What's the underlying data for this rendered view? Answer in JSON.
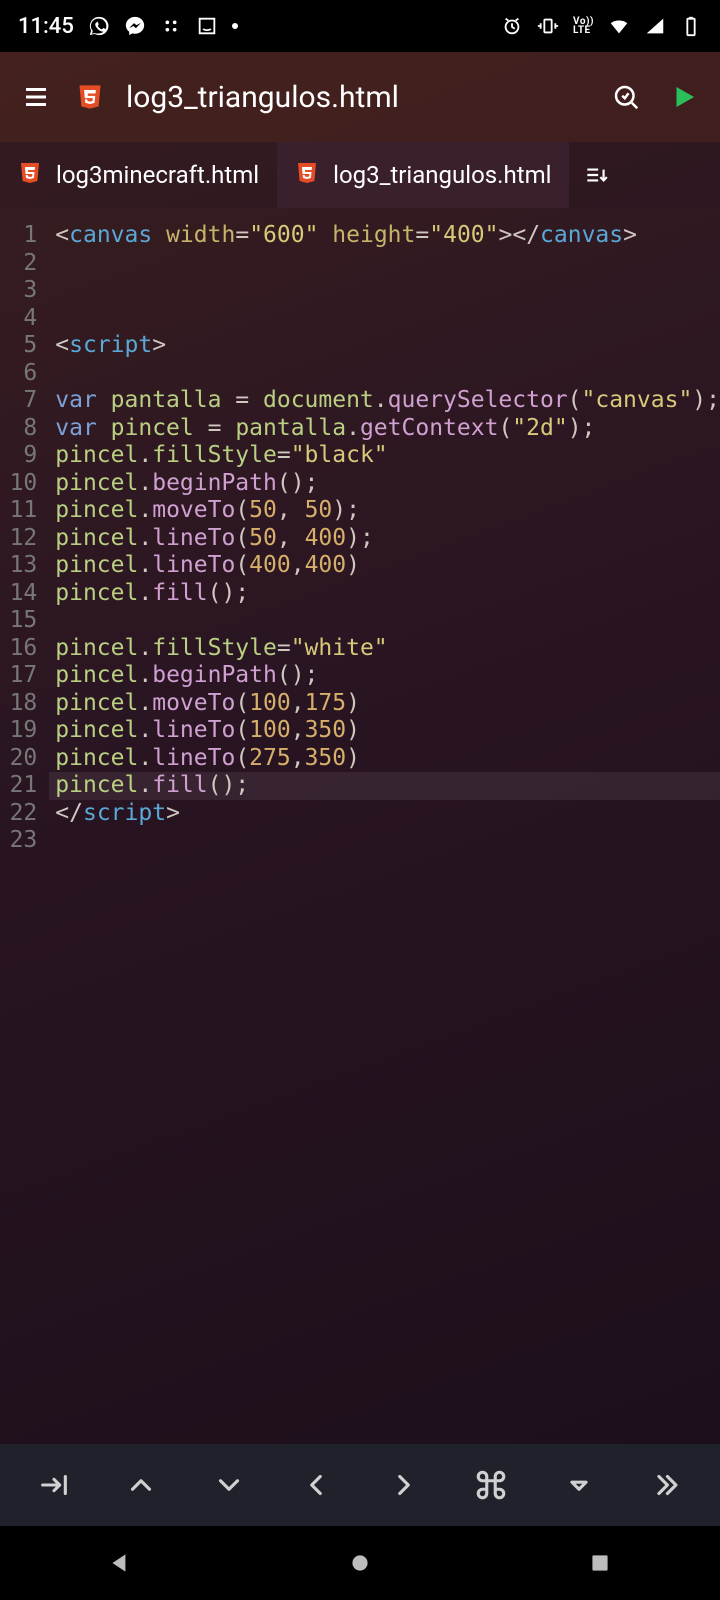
{
  "status": {
    "time": "11:45",
    "volte": "Vo))\nLTE"
  },
  "appbar": {
    "title": "log3_triangulos.html"
  },
  "tabs": [
    {
      "label": "log3minecraft.html",
      "active": false
    },
    {
      "label": "log3_triangulos.html",
      "active": true
    }
  ],
  "editor": {
    "cursor_line": 21,
    "lines": [
      {
        "n": 1,
        "tokens": [
          [
            "t-punc",
            "<"
          ],
          [
            "t-tag",
            "canvas"
          ],
          [
            "t-def",
            " "
          ],
          [
            "t-attr",
            "width"
          ],
          [
            "t-punc",
            "="
          ],
          [
            "t-str",
            "\"600\""
          ],
          [
            "t-def",
            " "
          ],
          [
            "t-attr",
            "height"
          ],
          [
            "t-punc",
            "="
          ],
          [
            "t-str",
            "\"400\""
          ],
          [
            "t-punc",
            "></"
          ],
          [
            "t-tag",
            "canvas"
          ],
          [
            "t-punc",
            ">"
          ]
        ]
      },
      {
        "n": 2,
        "tokens": []
      },
      {
        "n": 3,
        "tokens": []
      },
      {
        "n": 4,
        "tokens": []
      },
      {
        "n": 5,
        "tokens": [
          [
            "t-punc",
            "<"
          ],
          [
            "t-tag",
            "script"
          ],
          [
            "t-punc",
            ">"
          ]
        ]
      },
      {
        "n": 6,
        "tokens": []
      },
      {
        "n": 7,
        "tokens": [
          [
            "t-kw",
            "var"
          ],
          [
            "t-def",
            " "
          ],
          [
            "t-id",
            "pantalla"
          ],
          [
            "t-def",
            " = "
          ],
          [
            "t-id",
            "document"
          ],
          [
            "t-punc",
            "."
          ],
          [
            "t-fn",
            "querySelector"
          ],
          [
            "t-punc",
            "("
          ],
          [
            "t-str",
            "\"canvas\""
          ],
          [
            "t-punc",
            ");"
          ]
        ]
      },
      {
        "n": 8,
        "tokens": [
          [
            "t-kw",
            "var"
          ],
          [
            "t-def",
            " "
          ],
          [
            "t-id",
            "pincel"
          ],
          [
            "t-def",
            " = "
          ],
          [
            "t-id",
            "pantalla"
          ],
          [
            "t-punc",
            "."
          ],
          [
            "t-fn",
            "getContext"
          ],
          [
            "t-punc",
            "("
          ],
          [
            "t-str",
            "\"2d\""
          ],
          [
            "t-punc",
            ");"
          ]
        ]
      },
      {
        "n": 9,
        "tokens": [
          [
            "t-id",
            "pincel"
          ],
          [
            "t-punc",
            "."
          ],
          [
            "t-id",
            "fillStyle"
          ],
          [
            "t-punc",
            "="
          ],
          [
            "t-str",
            "\"black\""
          ]
        ]
      },
      {
        "n": 10,
        "tokens": [
          [
            "t-id",
            "pincel"
          ],
          [
            "t-punc",
            "."
          ],
          [
            "t-fn",
            "beginPath"
          ],
          [
            "t-punc",
            "();"
          ]
        ]
      },
      {
        "n": 11,
        "tokens": [
          [
            "t-id",
            "pincel"
          ],
          [
            "t-punc",
            "."
          ],
          [
            "t-fn",
            "moveTo"
          ],
          [
            "t-punc",
            "("
          ],
          [
            "t-num",
            "50"
          ],
          [
            "t-punc",
            ", "
          ],
          [
            "t-num",
            "50"
          ],
          [
            "t-punc",
            ");"
          ]
        ]
      },
      {
        "n": 12,
        "tokens": [
          [
            "t-id",
            "pincel"
          ],
          [
            "t-punc",
            "."
          ],
          [
            "t-fn",
            "lineTo"
          ],
          [
            "t-punc",
            "("
          ],
          [
            "t-num",
            "50"
          ],
          [
            "t-punc",
            ", "
          ],
          [
            "t-num",
            "400"
          ],
          [
            "t-punc",
            ");"
          ]
        ]
      },
      {
        "n": 13,
        "tokens": [
          [
            "t-id",
            "pincel"
          ],
          [
            "t-punc",
            "."
          ],
          [
            "t-fn",
            "lineTo"
          ],
          [
            "t-punc",
            "("
          ],
          [
            "t-num",
            "400"
          ],
          [
            "t-punc",
            ","
          ],
          [
            "t-num",
            "400"
          ],
          [
            "t-punc",
            ")"
          ]
        ]
      },
      {
        "n": 14,
        "tokens": [
          [
            "t-id",
            "pincel"
          ],
          [
            "t-punc",
            "."
          ],
          [
            "t-fn",
            "fill"
          ],
          [
            "t-punc",
            "();"
          ]
        ]
      },
      {
        "n": 15,
        "tokens": []
      },
      {
        "n": 16,
        "tokens": [
          [
            "t-id",
            "pincel"
          ],
          [
            "t-punc",
            "."
          ],
          [
            "t-id",
            "fillStyle"
          ],
          [
            "t-punc",
            "="
          ],
          [
            "t-str",
            "\"white\""
          ]
        ]
      },
      {
        "n": 17,
        "tokens": [
          [
            "t-id",
            "pincel"
          ],
          [
            "t-punc",
            "."
          ],
          [
            "t-fn",
            "beginPath"
          ],
          [
            "t-punc",
            "();"
          ]
        ]
      },
      {
        "n": 18,
        "tokens": [
          [
            "t-id",
            "pincel"
          ],
          [
            "t-punc",
            "."
          ],
          [
            "t-fn",
            "moveTo"
          ],
          [
            "t-punc",
            "("
          ],
          [
            "t-num",
            "100"
          ],
          [
            "t-punc",
            ","
          ],
          [
            "t-num",
            "175"
          ],
          [
            "t-punc",
            ")"
          ]
        ]
      },
      {
        "n": 19,
        "tokens": [
          [
            "t-id",
            "pincel"
          ],
          [
            "t-punc",
            "."
          ],
          [
            "t-fn",
            "lineTo"
          ],
          [
            "t-punc",
            "("
          ],
          [
            "t-num",
            "100"
          ],
          [
            "t-punc",
            ","
          ],
          [
            "t-num",
            "350"
          ],
          [
            "t-punc",
            ")"
          ]
        ]
      },
      {
        "n": 20,
        "tokens": [
          [
            "t-id",
            "pincel"
          ],
          [
            "t-punc",
            "."
          ],
          [
            "t-fn",
            "lineTo"
          ],
          [
            "t-punc",
            "("
          ],
          [
            "t-num",
            "275"
          ],
          [
            "t-punc",
            ","
          ],
          [
            "t-num",
            "350"
          ],
          [
            "t-punc",
            ")"
          ]
        ]
      },
      {
        "n": 21,
        "tokens": [
          [
            "t-id",
            "pincel"
          ],
          [
            "t-punc",
            "."
          ],
          [
            "t-fn",
            "fill"
          ],
          [
            "t-punc",
            "();"
          ]
        ]
      },
      {
        "n": 22,
        "tokens": [
          [
            "t-punc",
            "</"
          ],
          [
            "t-tag",
            "script"
          ],
          [
            "t-punc",
            ">"
          ]
        ]
      },
      {
        "n": 23,
        "tokens": []
      }
    ]
  }
}
